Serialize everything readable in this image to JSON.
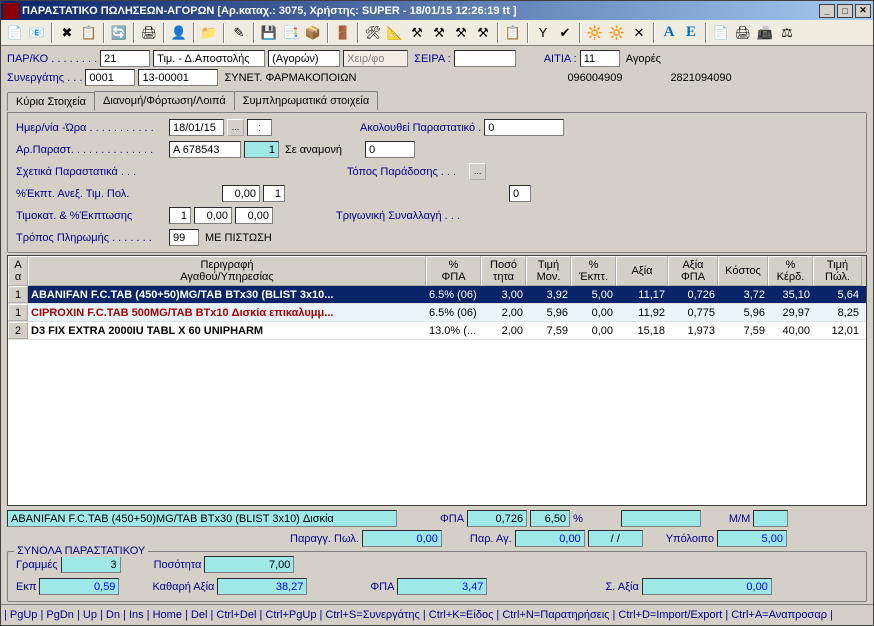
{
  "title": "ΠΑΡΑΣΤΑΤΙΚΟ ΠΩΛΗΣΕΩΝ-ΑΓΟΡΩΝ [Αρ.καταχ.: 3075, Χρήστης: SUPER - 18/01/15 12:26:19 tt ]",
  "toolbar_icons": [
    "📄",
    "📧",
    "✖",
    "📋",
    "🔄",
    "🖨",
    "👤",
    "📁",
    "✎",
    "💾",
    "📑",
    "📦",
    "🚪",
    "🛠",
    "📐",
    "⚒",
    "⚒",
    "⚒",
    "⚒",
    "📋",
    "Υ",
    "✔",
    "🔆",
    "🔆",
    "✕"
  ],
  "toolbar_letters": [
    "Α",
    "Ε"
  ],
  "toolbar_more": [
    "📄",
    "🖨",
    "📠",
    "⚖"
  ],
  "header": {
    "parko_label": "ΠΑΡ/ΚΟ . . . . . . . .",
    "parko": "21",
    "series_type": "Τιμ. - Δ.Αποστολής",
    "kind": "(Αγορών)",
    "cheir": "Χειρ/φο",
    "seira_label": "ΣΕΙΡΑ :",
    "aitia_label": "ΑΙΤΙΑ :",
    "aitia": "11",
    "aitia_txt": "Αγορές",
    "syn_label": "Συνεργάτης . . .",
    "syn_code": "0001",
    "syn_num": "13-00001",
    "syn_name": "ΣΥΝΕΤ. ΦΑΡΜΑΚΟΠΟΙΩΝ",
    "afm": "096004909",
    "doy": "2821094090"
  },
  "tabs": [
    "Κύρια Στοιχεία",
    "Διανομή/Φόρτωση/Λοιπά",
    "Συμπληρωματικά στοιχεία"
  ],
  "main": {
    "date_label": "Ημερ/νία -Ώρα . . . . . . . . . . .",
    "date": "18/01/15",
    "time": ":",
    "follows_label": "Ακολουθεί Παραστατικό .",
    "follows": "0",
    "arpar_label": "Αρ.Παραστ. . . . . . . . . . . . . .",
    "arpar": "Α 678543",
    "arpar2": "1",
    "status": "Σε αναμονή",
    "status_val": "0",
    "sxetika_label": "Σχετικά Παραστατικά . . .",
    "topos_label": "Τόπος Παράδοσης . . .",
    "ekpt_label": "%Έκπτ. Ανεξ. Τιμ. Πολ.",
    "ekpt1": "0,00",
    "ekpt2": "1",
    "trig_label": "Τριγωνική Συναλλαγή . . .",
    "timokat_label": "Τιμοκατ. & %Έκπτωσης",
    "tk1": "1",
    "tk2": "0,00",
    "tk3": "0,00",
    "tropos_label": "Τρόπος Πληρωμής . . . . . . .",
    "tropos": "99",
    "tropos_txt": "ΜΕ ΠΙΣΤΩΣΗ"
  },
  "grid": {
    "headers": [
      "Α\nα",
      "Περιγραφή\nΑγαθού/Υπηρεσίας",
      "%\nΦΠΑ",
      "Ποσό\nτητα",
      "Τιμή\nΜον.",
      "%\nΈκπτ.",
      "Αξία",
      "Αξία\nΦΠΑ",
      "Κόστος",
      "%\nΚέρδ.",
      "Τιμή\nΠώλ."
    ],
    "rows": [
      {
        "aa": "1",
        "desc": "ABANIFAN F.C.TAB (450+50)MG/TAB BTx30 (BLIST 3x10...",
        "fpa": "6.5% (06)",
        "poso": "3,00",
        "tim": "3,92",
        "ekpt": "5,00",
        "axia": "11,17",
        "axiafpa": "0,726",
        "kostos": "3,72",
        "kerd": "35,10",
        "timpol": "5,64",
        "sel": true
      },
      {
        "aa": "1",
        "desc": "CIPROXIN F.C.TAB 500MG/TAB BTx10 Δισκία επικαλυμμ...",
        "fpa": "6.5% (06)",
        "poso": "2,00",
        "tim": "5,96",
        "ekpt": "0,00",
        "axia": "11,92",
        "axiafpa": "0,775",
        "kostos": "5,96",
        "kerd": "29,97",
        "timpol": "8,25",
        "alt": true,
        "hl": true
      },
      {
        "aa": "2",
        "desc": "D3 FIX EXTRA 2000IU TABL X 60 UNIPHARM",
        "fpa": "13.0% (...",
        "poso": "2,00",
        "tim": "7,59",
        "ekpt": "0,00",
        "axia": "15,18",
        "axiafpa": "1,973",
        "kostos": "7,59",
        "kerd": "40,00",
        "timpol": "12,01"
      }
    ]
  },
  "below": {
    "item_desc": "ABANIFAN F.C.TAB (450+50)MG/TAB BTx30 (BLIST 3x10) Δισκία",
    "fpa_label": "ΦΠΑ",
    "fpa": "0,726",
    "fpa_pct": "6,50",
    "pct": "%",
    "mm_label": "Μ/Μ",
    "parag_label": "Παραγγ. Πωλ.",
    "parag": "0,00",
    "parag2_label": "Παρ. Αγ.",
    "parag2": "0,00",
    "slash": "/   /",
    "ypoloipo_label": "Υπόλοιπο",
    "ypoloipo": "5,00"
  },
  "totals": {
    "legend": "ΣΥΝΟΛΑ ΠΑΡΑΣΤΑΤΙΚΟΥ",
    "lines_label": "Γραμμές",
    "lines": "3",
    "qty_label": "Ποσότητα",
    "qty": "7,00",
    "ekp_label": "Εκπ",
    "ekp": "0,59",
    "net_label": "Καθαρή Αξία",
    "net": "38,27",
    "fpa_label": "ΦΠΑ",
    "fpa": "3,47",
    "sum_label": "Σ. Αξία",
    "sum": "0,00"
  },
  "statusbar": [
    "PgUp",
    "PgDn",
    "Up",
    "Dn",
    "Ins",
    "Home",
    "Del",
    "Ctrl+Del",
    "Ctrl+PgUp",
    "Ctrl+S=Συνεργάτης",
    "Ctrl+K=Εἰδος",
    "Ctrl+N=Παρατηρήσεις",
    "Ctrl+D=Import/Export",
    "Ctrl+A=Αναπροσαρ"
  ]
}
